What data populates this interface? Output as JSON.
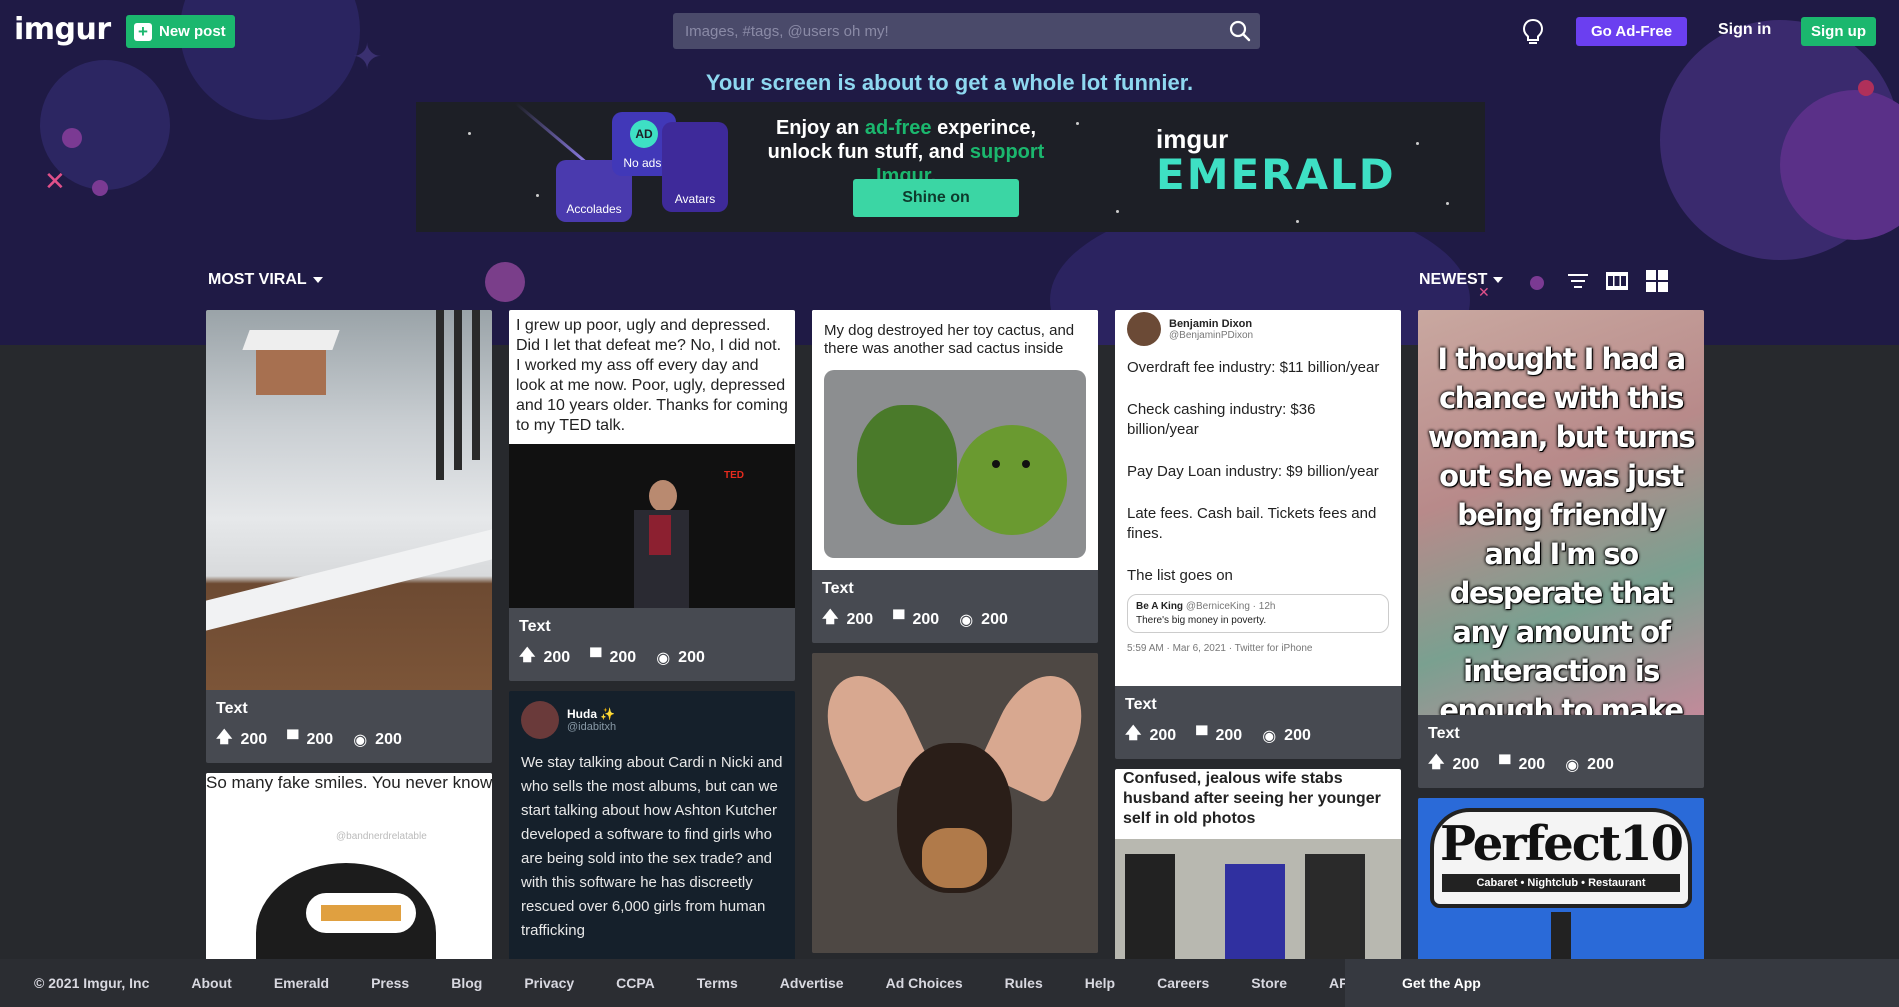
{
  "header": {
    "logo": "imgur",
    "new_post_label": "New post",
    "search_placeholder": "Images, #tags, @users oh my!",
    "ad_free_label": "Go Ad-Free",
    "sign_in_label": "Sign in",
    "sign_up_label": "Sign up"
  },
  "promo": {
    "tagline": "Your screen is about to get a whole lot funnier.",
    "headline_part1": "Enjoy an ",
    "headline_green1": "ad-free",
    "headline_part2": " experince, unlock fun stuff, and ",
    "headline_green2": "support Imgur",
    "headline_end": ".",
    "cta_label": "Shine on",
    "brand_small": "imgur",
    "brand_big": "EMERALD",
    "cards": [
      "Accolades",
      "No ads!",
      "Avatars"
    ],
    "ad_badge": "AD"
  },
  "sort": {
    "left_label": "MOST VIRAL",
    "right_label": "NEWEST"
  },
  "posts": {
    "snow": {
      "title": "Text",
      "ups": "200",
      "comments": "200",
      "views": "200"
    },
    "ted": {
      "caption": "I grew up poor, ugly and depressed. Did I let that defeat me? No, I did not. I worked my ass off every day and look at me now. Poor, ugly, depressed and 10 years older. Thanks for coming to my TED talk.",
      "title": "Text",
      "ups": "200",
      "comments": "200",
      "views": "200"
    },
    "cactus": {
      "caption": "My dog destroyed her toy cactus, and there was another sad cactus inside",
      "title": "Text",
      "ups": "200",
      "comments": "200",
      "views": "200"
    },
    "tweet": {
      "name": "Benjamin Dixon",
      "handle": "@BenjaminPDixon",
      "lines": [
        "Overdraft fee industry: $11 billion/year",
        "Check cashing industry: $36 billion/year",
        "Pay Day Loan industry: $9 billion/year",
        "Late fees. Cash bail. Tickets fees and fines.",
        "The list goes on"
      ],
      "quote_name": "Be A King",
      "quote_handle": "@BerniceKing · 12h",
      "quote_text": "There's big money in poverty.",
      "timestamp": "5:59 AM · Mar 6, 2021 · Twitter for iPhone",
      "title": "Text",
      "ups": "200",
      "comments": "200",
      "views": "200"
    },
    "whisper": {
      "caption": "I thought I had a chance with this woman, but turns out she was just being friendly and I'm so desperate that any amount of interaction is enough to make me think someone is interested.",
      "title": "Text",
      "ups": "200",
      "comments": "200",
      "views": "200"
    },
    "smiles": {
      "caption": "So many fake smiles. You never know what someone is going through.",
      "watermark": "@bandnerdrelatable"
    },
    "huda": {
      "name": "Huda ✨",
      "handle": "@idabitxh",
      "text": "We stay talking about Cardi n Nicki and who sells the most albums, but can we start talking about how Ashton Kutcher developed a software to find girls who are being sold into the sex trade? and with this software he has discreetly rescued over 6,000 girls from human trafficking"
    },
    "wife": {
      "caption": "Confused, jealous wife stabs husband after seeing her younger self in old photos"
    },
    "perfect10": {
      "brand": "Perfect10",
      "sub": "Cabaret • Nightclub • Restaurant"
    }
  },
  "footer": {
    "copyright": "© 2021 Imgur, Inc",
    "links": [
      "About",
      "Emerald",
      "Press",
      "Blog",
      "Privacy",
      "CCPA",
      "Terms",
      "Advertise",
      "Ad Choices",
      "Rules",
      "Help",
      "Careers",
      "Store",
      "API"
    ],
    "get_app": "Get the App"
  },
  "colors": {
    "accent_green": "#1bb76e",
    "ad_free_purple": "#6b3ff0",
    "emerald": "#3ee0c4",
    "header_bg": "#1f1a45"
  }
}
